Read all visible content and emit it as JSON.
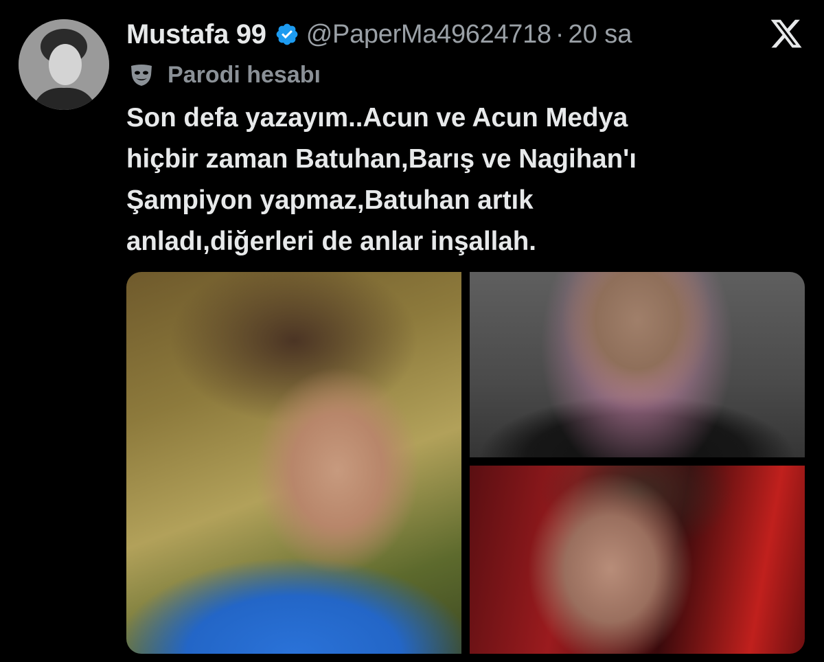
{
  "tweet": {
    "display_name": "Mustafa 99",
    "handle": "@PaperMa49624718",
    "separator": "·",
    "time": "20 sa",
    "label": "Parodi hesabı",
    "text_lines": [
      "Son defa yazayım..Acun ve Acun Medya",
      "hiçbir zaman Batuhan,Barış ve Nagihan'ı",
      "Şampiyon yapmaz,Batuhan artık",
      "anladı,diğerleri de anlar inşallah."
    ]
  },
  "icons": {
    "verified": "verified-badge-icon",
    "parody": "parody-mask-icon",
    "platform": "x-logo-icon"
  },
  "colors": {
    "background": "#000000",
    "text": "#e7e9ea",
    "muted": "#9aa0a6",
    "verified_blue": "#1d9bf0"
  }
}
